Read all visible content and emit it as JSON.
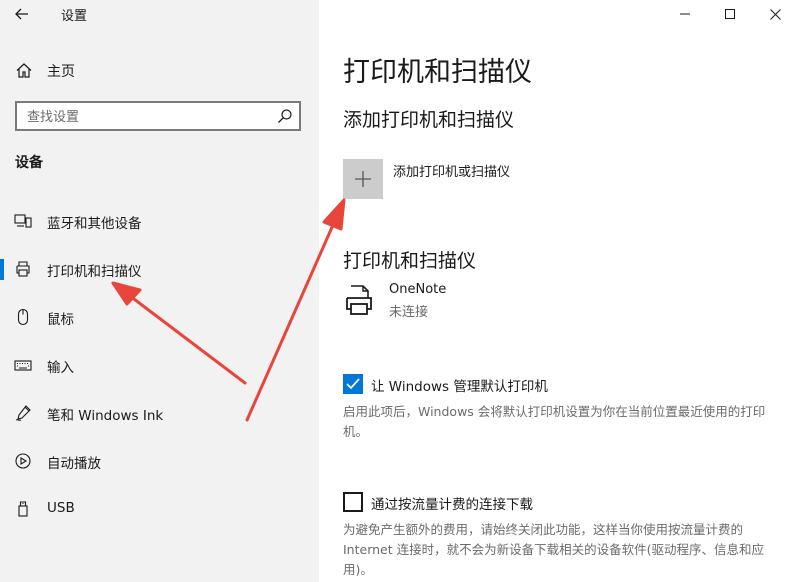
{
  "window": {
    "app_title": "设置",
    "controls": [
      "minimize-icon",
      "maximize-icon",
      "close-icon"
    ]
  },
  "sidebar": {
    "home_label": "主页",
    "search_placeholder": "查找设置",
    "section_title": "设备",
    "items": [
      {
        "label": "蓝牙和其他设备",
        "icon": "bluetooth-devices-icon",
        "selected": false
      },
      {
        "label": "打印机和扫描仪",
        "icon": "printer-icon",
        "selected": true
      },
      {
        "label": "鼠标",
        "icon": "mouse-icon",
        "selected": false
      },
      {
        "label": "输入",
        "icon": "keyboard-icon",
        "selected": false
      },
      {
        "label": "笔和 Windows Ink",
        "icon": "pen-icon",
        "selected": false
      },
      {
        "label": "自动播放",
        "icon": "autoplay-icon",
        "selected": false
      },
      {
        "label": "USB",
        "icon": "usb-icon",
        "selected": false
      }
    ]
  },
  "main": {
    "title": "打印机和扫描仪",
    "add_section_title": "添加打印机和扫描仪",
    "add_button_label": "添加打印机或扫描仪",
    "printers_section_title": "打印机和扫描仪",
    "printers": [
      {
        "name": "OneNote",
        "status": "未连接",
        "icon": "printer-document-icon"
      }
    ],
    "default_printer": {
      "checked": true,
      "label": "让 Windows 管理默认打印机",
      "description": "启用此项后，Windows 会将默认打印机设置为你在当前位置最近使用的打印机。"
    },
    "metered": {
      "checked": false,
      "label": "通过按流量计费的连接下载",
      "description": "为避免产生额外的费用，请始终关闭此功能，这样当你使用按流量计费的 Internet 连接时，就不会为新设备下载相关的设备软件(驱动程序、信息和应用)。"
    }
  },
  "colors": {
    "accent": "#0078d7",
    "sidebar_bg": "#f2f2f2",
    "annotation_arrow": "#e8453c"
  }
}
